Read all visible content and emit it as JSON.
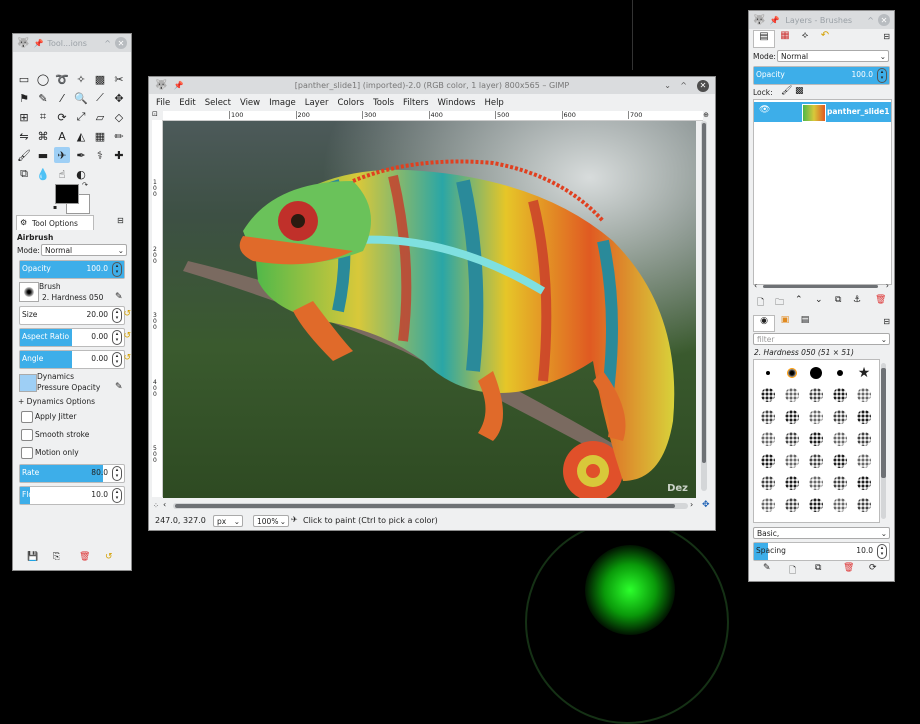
{
  "colors": {
    "accent": "#3daee9",
    "desktop": "#000000",
    "glow": "#19e619"
  },
  "toolbox": {
    "title": "Tool...ions",
    "tools": [
      "rect-select-icon",
      "ellipse-select-icon",
      "lasso-icon",
      "fuzzy-select-icon",
      "color-select-icon",
      "scissors-icon",
      "foreground-select-icon",
      "paths-icon",
      "color-picker-icon",
      "zoom-icon",
      "measure-icon",
      "move-icon",
      "align-icon",
      "crop-icon",
      "rotate-icon",
      "scale-icon",
      "shear-icon",
      "perspective-icon",
      "flip-icon",
      "cage-icon",
      "text-icon",
      "bucket-fill-icon",
      "blend-icon",
      "pencil-icon",
      "paintbrush-icon",
      "eraser-icon",
      "airbrush-icon",
      "ink-icon",
      "clone-icon",
      "heal-icon",
      "perspective-clone-icon",
      "blur-icon",
      "smudge-icon",
      "dodge-burn-icon"
    ],
    "tool_glyphs": [
      "▭",
      "◯",
      "➰",
      "✧",
      "▩",
      "✂",
      "⚑",
      "✎",
      "⁄",
      "🔍",
      "⟋",
      "✥",
      "⊞",
      "⌗",
      "⟳",
      "⤢",
      "▱",
      "◇",
      "⇋",
      "⌘",
      "A",
      "◭",
      "▦",
      "✏",
      "🖌",
      "▬",
      "✈",
      "✒",
      "⚕",
      "✚",
      "⧉",
      "💧",
      "☝",
      "◐"
    ],
    "tab_label": "Tool Options",
    "tool_name": "Airbrush",
    "mode_label": "Mode:",
    "mode_value": "Normal",
    "opacity_label": "Opacity",
    "opacity_value": "100.0",
    "brush_label": "Brush",
    "brush_value": "2. Hardness 050",
    "size_label": "Size",
    "size_value": "20.00",
    "aspect_label": "Aspect Ratio",
    "aspect_value": "0.00",
    "angle_label": "Angle",
    "angle_value": "0.00",
    "dynamics_label": "Dynamics",
    "dynamics_value": "Pressure Opacity",
    "dynamics_options_label": "+ Dynamics Options",
    "jitter_label": "Apply Jitter",
    "smooth_label": "Smooth stroke",
    "motion_label": "Motion only",
    "rate_label": "Rate",
    "rate_value": "80.0",
    "flow_label": "Flow",
    "flow_value": "10.0",
    "opacity_fraction": 1.0,
    "aspect_fraction": 0.5,
    "angle_fraction": 0.5,
    "rate_fraction": 0.8,
    "flow_fraction": 0.1
  },
  "image_window": {
    "title": "[panther_slide1] (imported)-2.0 (RGB color, 1 layer) 800x565 – GIMP",
    "menu": [
      "File",
      "Edit",
      "Select",
      "View",
      "Image",
      "Layer",
      "Colors",
      "Tools",
      "Filters",
      "Windows",
      "Help"
    ],
    "ruler_top": [
      "100",
      "200",
      "300",
      "400",
      "500",
      "600",
      "700"
    ],
    "ruler_left": [
      "100",
      "200",
      "300",
      "400",
      "500"
    ],
    "watermark": "Dez",
    "status_coords": "247.0, 327.0",
    "status_unit": "px",
    "status_zoom": "100%",
    "status_message": "Click to paint (Ctrl to pick a color)"
  },
  "layers_panel": {
    "title": "Layers - Brushes",
    "mode_label": "Mode:",
    "mode_value": "Normal",
    "opacity_label": "Opacity",
    "opacity_value": "100.0",
    "lock_label": "Lock:",
    "layer_name": "panther_slide1",
    "brush_filter_placeholder": "filter",
    "brush_name": "2. Hardness 050 (51 × 51)",
    "brush_category": "Basic,",
    "spacing_label": "Spacing",
    "spacing_value": "10.0",
    "spacing_fraction": 0.1
  }
}
